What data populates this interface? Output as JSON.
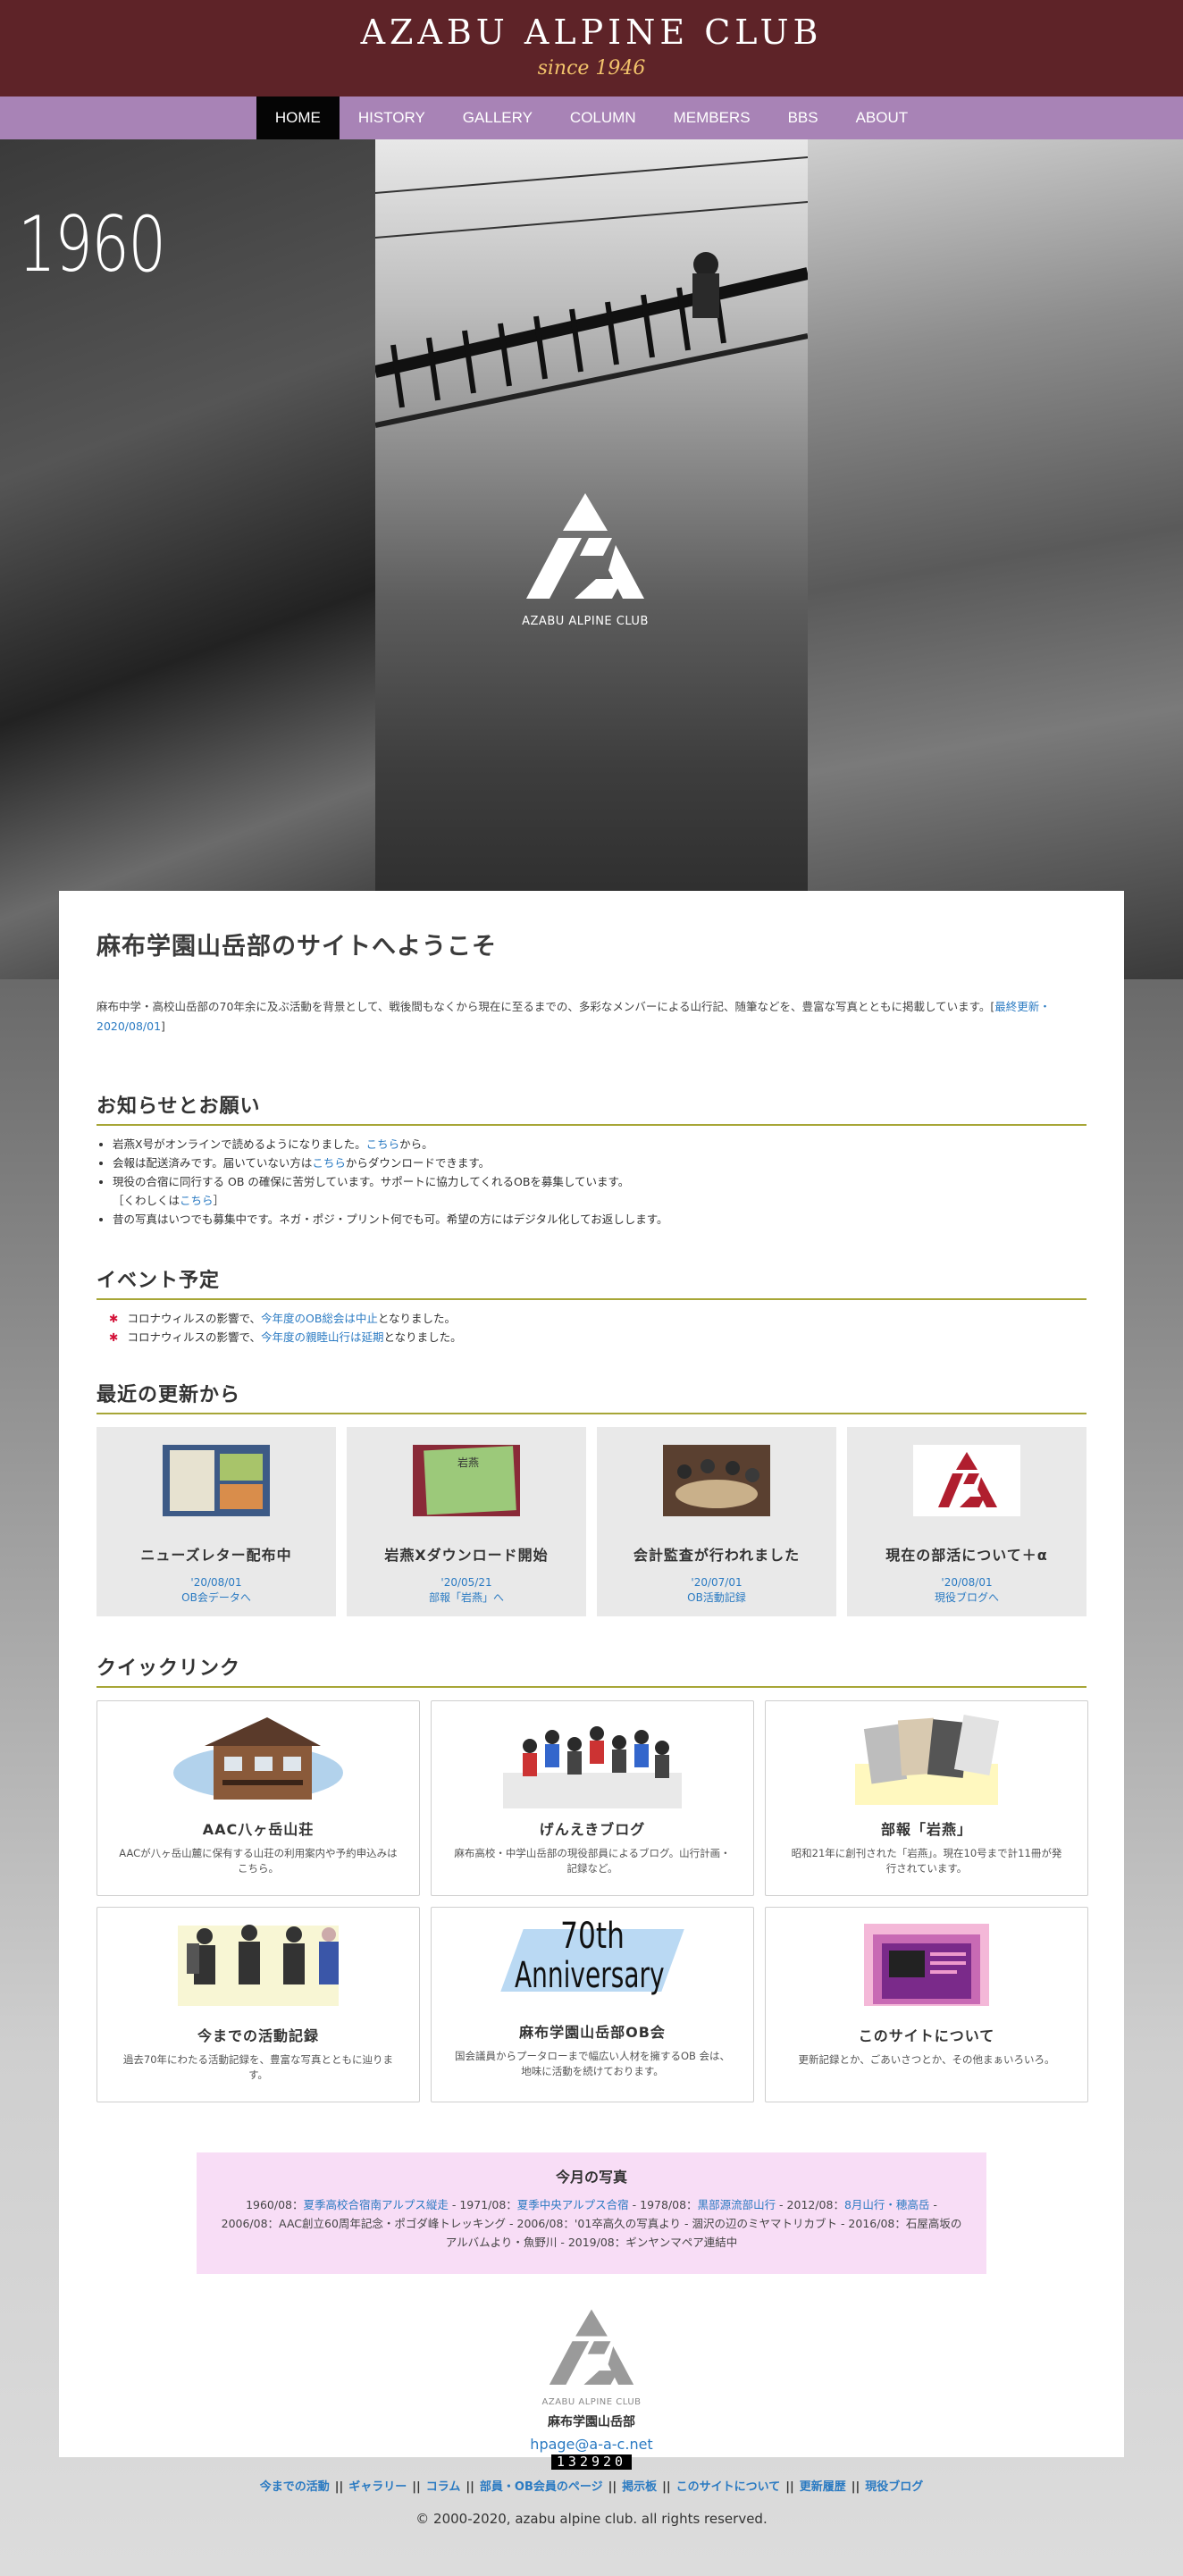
{
  "header": {
    "title": "AZABU ALPINE CLUB",
    "subtitle": "since 1946"
  },
  "nav": [
    "HOME",
    "HISTORY",
    "GALLERY",
    "COLUMN",
    "MEMBERS",
    "BBS",
    "ABOUT"
  ],
  "hero": {
    "year": "1960",
    "logo_text": "AZABU ALPINE CLUB"
  },
  "welcome": {
    "title": "麻布学園山岳部のサイトへようこそ",
    "intro": "麻布中学・高校山岳部の70年余に及ぶ活動を背景として、戦後間もなくから現在に至るまでの、多彩なメンバーによる山行記、随筆などを、豊富な写真とともに掲載しています。[",
    "intro_link": "最終更新・2020/08/01",
    "intro_end": "]"
  },
  "notice": {
    "title": "お知らせとお願い",
    "items": [
      {
        "text": "岩燕X号がオンラインで読めるようになりました。",
        "link": "こちら",
        "after": "から。"
      },
      {
        "text": "会報は配送済みです。届いていない方は",
        "link": "こちら",
        "after": "からダウンロードできます。"
      },
      {
        "text": "現役の合宿に同行する OB の確保に苦労しています。サポートに協力してくれるOBを募集しています。",
        "link": "",
        "after": ""
      },
      {
        "text": "［くわしくは",
        "link": "こちら",
        "after": "］"
      },
      {
        "text": "昔の写真はいつでも募集中です。ネガ・ポジ・プリント何でも可。希望の方にはデジタル化してお返しします。",
        "link": "",
        "after": ""
      }
    ]
  },
  "events": {
    "title": "イベント予定",
    "items": [
      {
        "text": "コロナウィルスの影響で、",
        "link": "今年度のOB総会は中止",
        "after": "となりました。"
      },
      {
        "text": "コロナウィルスの影響で、",
        "link": "今年度の親睦山行は延期",
        "after": "となりました。"
      }
    ]
  },
  "recent": {
    "title": "最近の更新から",
    "items": [
      {
        "title": "ニューズレター配布中",
        "date": "'20/08/01",
        "link": "OB会データへ"
      },
      {
        "title": "岩燕Xダウンロード開始",
        "date": "'20/05/21",
        "link": "部報「岩燕」へ"
      },
      {
        "title": "会計監査が行われました",
        "date": "'20/07/01",
        "link": "OB活動記録"
      },
      {
        "title": "現在の部活について＋α",
        "date": "'20/08/01",
        "link": "現役ブログへ"
      }
    ]
  },
  "quick": {
    "title": "クイックリンク",
    "items": [
      {
        "title": "AAC八ヶ岳山荘",
        "desc": "AACが八ヶ岳山麓に保有する山荘の利用案内や予約申込みはこちら。"
      },
      {
        "title": "げんえきブログ",
        "desc": "麻布高校・中学山岳部の現役部員によるブログ。山行計画・記録など。"
      },
      {
        "title": "部報「岩燕」",
        "desc": "昭和21年に創刊された「岩燕」。現在10号まで計11冊が発行されています。"
      },
      {
        "title": "今までの活動記録",
        "desc": "過去70年にわたる活動記録を、豊富な写真とともに辿ります。"
      },
      {
        "title": "麻布学園山岳部OB会",
        "desc": "国会議員からプータローまで幅広い人材を擁するOB 会は、地味に活動を続けております。"
      },
      {
        "title": "このサイトについて",
        "desc": "更新記録とか、ごあいさつとか、その他まぁいろいろ。"
      }
    ],
    "anniversary_line1": "70th",
    "anniversary_line2": "Anniversary"
  },
  "photos": {
    "title": "今月の写真",
    "segments": [
      {
        "text": "1960/08：",
        "link": "夏季高校合宿南アルプス縦走"
      },
      {
        "text": " - 1971/08：",
        "link": "夏季中央アルプス合宿"
      },
      {
        "text": " - 1978/08：",
        "link": "黒部源流部山行"
      },
      {
        "text": " - 2012/08：",
        "link": "8月山行・穂高岳"
      },
      {
        "text": " - 2006/08：AAC創立60周年記念・ポゴダ峰トレッキング - 2006/08：'01卒高久の写真より - 涸沢の辺のミヤマトリカブト - 2016/08：石屋高坂のアルバムより・魚野川 - 2019/08：ギンヤンマペア連結中",
        "link": ""
      }
    ]
  },
  "footer": {
    "logo_text": "AZABU ALPINE CLUB",
    "name": "麻布学園山岳部",
    "mail": "hpage@a-a-c.net",
    "counter": "132920",
    "links": [
      "今までの活動",
      "ギャラリー",
      "コラム",
      "部員・OB会員のページ",
      "掲示板",
      "このサイトについて",
      "更新履歴",
      "現役ブログ"
    ],
    "copyright": "© 2000-2020, azabu alpine club. all rights reserved."
  },
  "colors": {
    "header_bg": "#5e2328",
    "nav_bg": "#a883b6",
    "accent_gold": "#f2c36b",
    "rule": "#a7a637",
    "link": "#2a7ac2",
    "logo_red": "#b01e2e"
  }
}
